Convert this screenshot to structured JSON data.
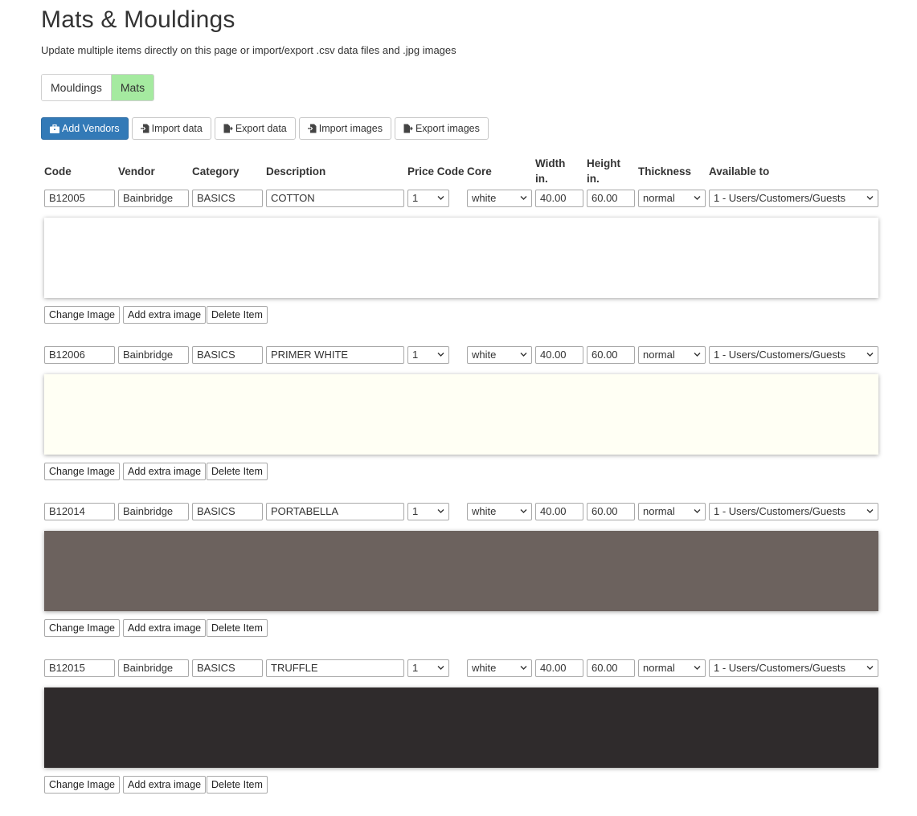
{
  "page": {
    "title": "Mats & Mouldings",
    "subtitle": "Update multiple items directly on this page or import/export .csv data files and .jpg images"
  },
  "tabs": [
    {
      "label": "Mouldings",
      "active": false
    },
    {
      "label": "Mats",
      "active": true
    }
  ],
  "toolbar": {
    "add_vendors": "Add Vendors",
    "import_data": "Import data",
    "export_data": "Export data",
    "import_images": "Import images",
    "export_images": "Export images"
  },
  "columns": {
    "code": "Code",
    "vendor": "Vendor",
    "category": "Category",
    "description": "Description",
    "price_code": "Price Code",
    "core": "Core",
    "width_line1": "Width",
    "width_line2": "in.",
    "height_line1": "Height",
    "height_line2": "in.",
    "thickness": "Thickness",
    "available_to": "Available to"
  },
  "actions": {
    "change_image": "Change Image",
    "add_extra_image": "Add extra image",
    "delete_item": "Delete Item"
  },
  "items": [
    {
      "code": "B12005",
      "vendor": "Bainbridge",
      "category": "BASICS",
      "description": "COTTON",
      "price_code": "1",
      "core": "white",
      "width": "40.00",
      "height": "60.00",
      "thickness": "normal",
      "available_to": "1 - Users/Customers/Guests",
      "swatch_color": "#ffffff"
    },
    {
      "code": "B12006",
      "vendor": "Bainbridge",
      "category": "BASICS",
      "description": "PRIMER WHITE",
      "price_code": "1",
      "core": "white",
      "width": "40.00",
      "height": "60.00",
      "thickness": "normal",
      "available_to": "1 - Users/Customers/Guests",
      "swatch_color": "#fffff4"
    },
    {
      "code": "B12014",
      "vendor": "Bainbridge",
      "category": "BASICS",
      "description": "PORTABELLA",
      "price_code": "1",
      "core": "white",
      "width": "40.00",
      "height": "60.00",
      "thickness": "normal",
      "available_to": "1 - Users/Customers/Guests",
      "swatch_color": "#6c625e"
    },
    {
      "code": "B12015",
      "vendor": "Bainbridge",
      "category": "BASICS",
      "description": "TRUFFLE",
      "price_code": "1",
      "core": "white",
      "width": "40.00",
      "height": "60.00",
      "thickness": "normal",
      "available_to": "1 - Users/Customers/Guests",
      "swatch_color": "#2f2b2c"
    }
  ]
}
